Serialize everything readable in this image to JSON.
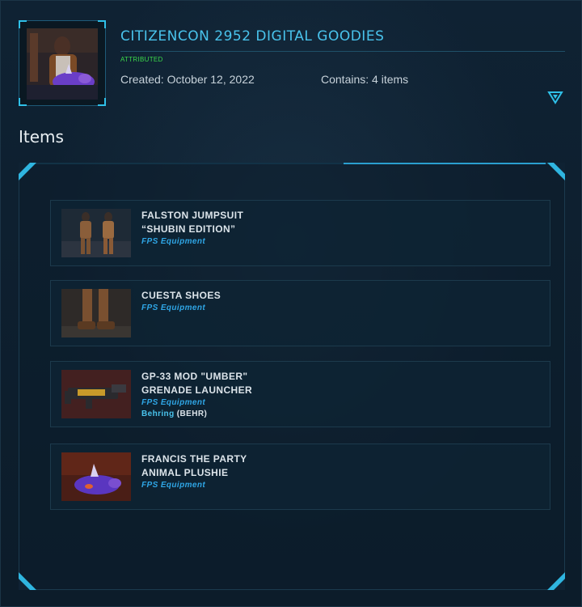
{
  "header": {
    "title": "CITIZENCON 2952 DIGITAL GOODIES",
    "status": "ATTRIBUTED",
    "created": "Created: October 12, 2022",
    "contains": "Contains: 4 items"
  },
  "section": {
    "heading": "Items"
  },
  "items": [
    {
      "name_line1": "FALSTON JUMPSUIT",
      "name_line2": "“SHUBIN EDITION”",
      "category": "FPS Equipment"
    },
    {
      "name_line1": "CUESTA SHOES",
      "name_line2": "",
      "category": "FPS Equipment"
    },
    {
      "name_line1": "GP-33 MOD \"UMBER\"",
      "name_line2": "GRENADE LAUNCHER",
      "category": "FPS Equipment",
      "manufacturer": "Behring",
      "manufacturer_code": "(BEHR)"
    },
    {
      "name_line1": "FRANCIS THE PARTY",
      "name_line2": "ANIMAL PLUSHIE",
      "category": "FPS Equipment"
    }
  ],
  "colors": {
    "accent": "#49c3ec",
    "status": "#3bd94a",
    "category": "#2fa6e6",
    "background": "#0f2233"
  },
  "icons": {
    "toggle": "triangle-down-icon"
  }
}
